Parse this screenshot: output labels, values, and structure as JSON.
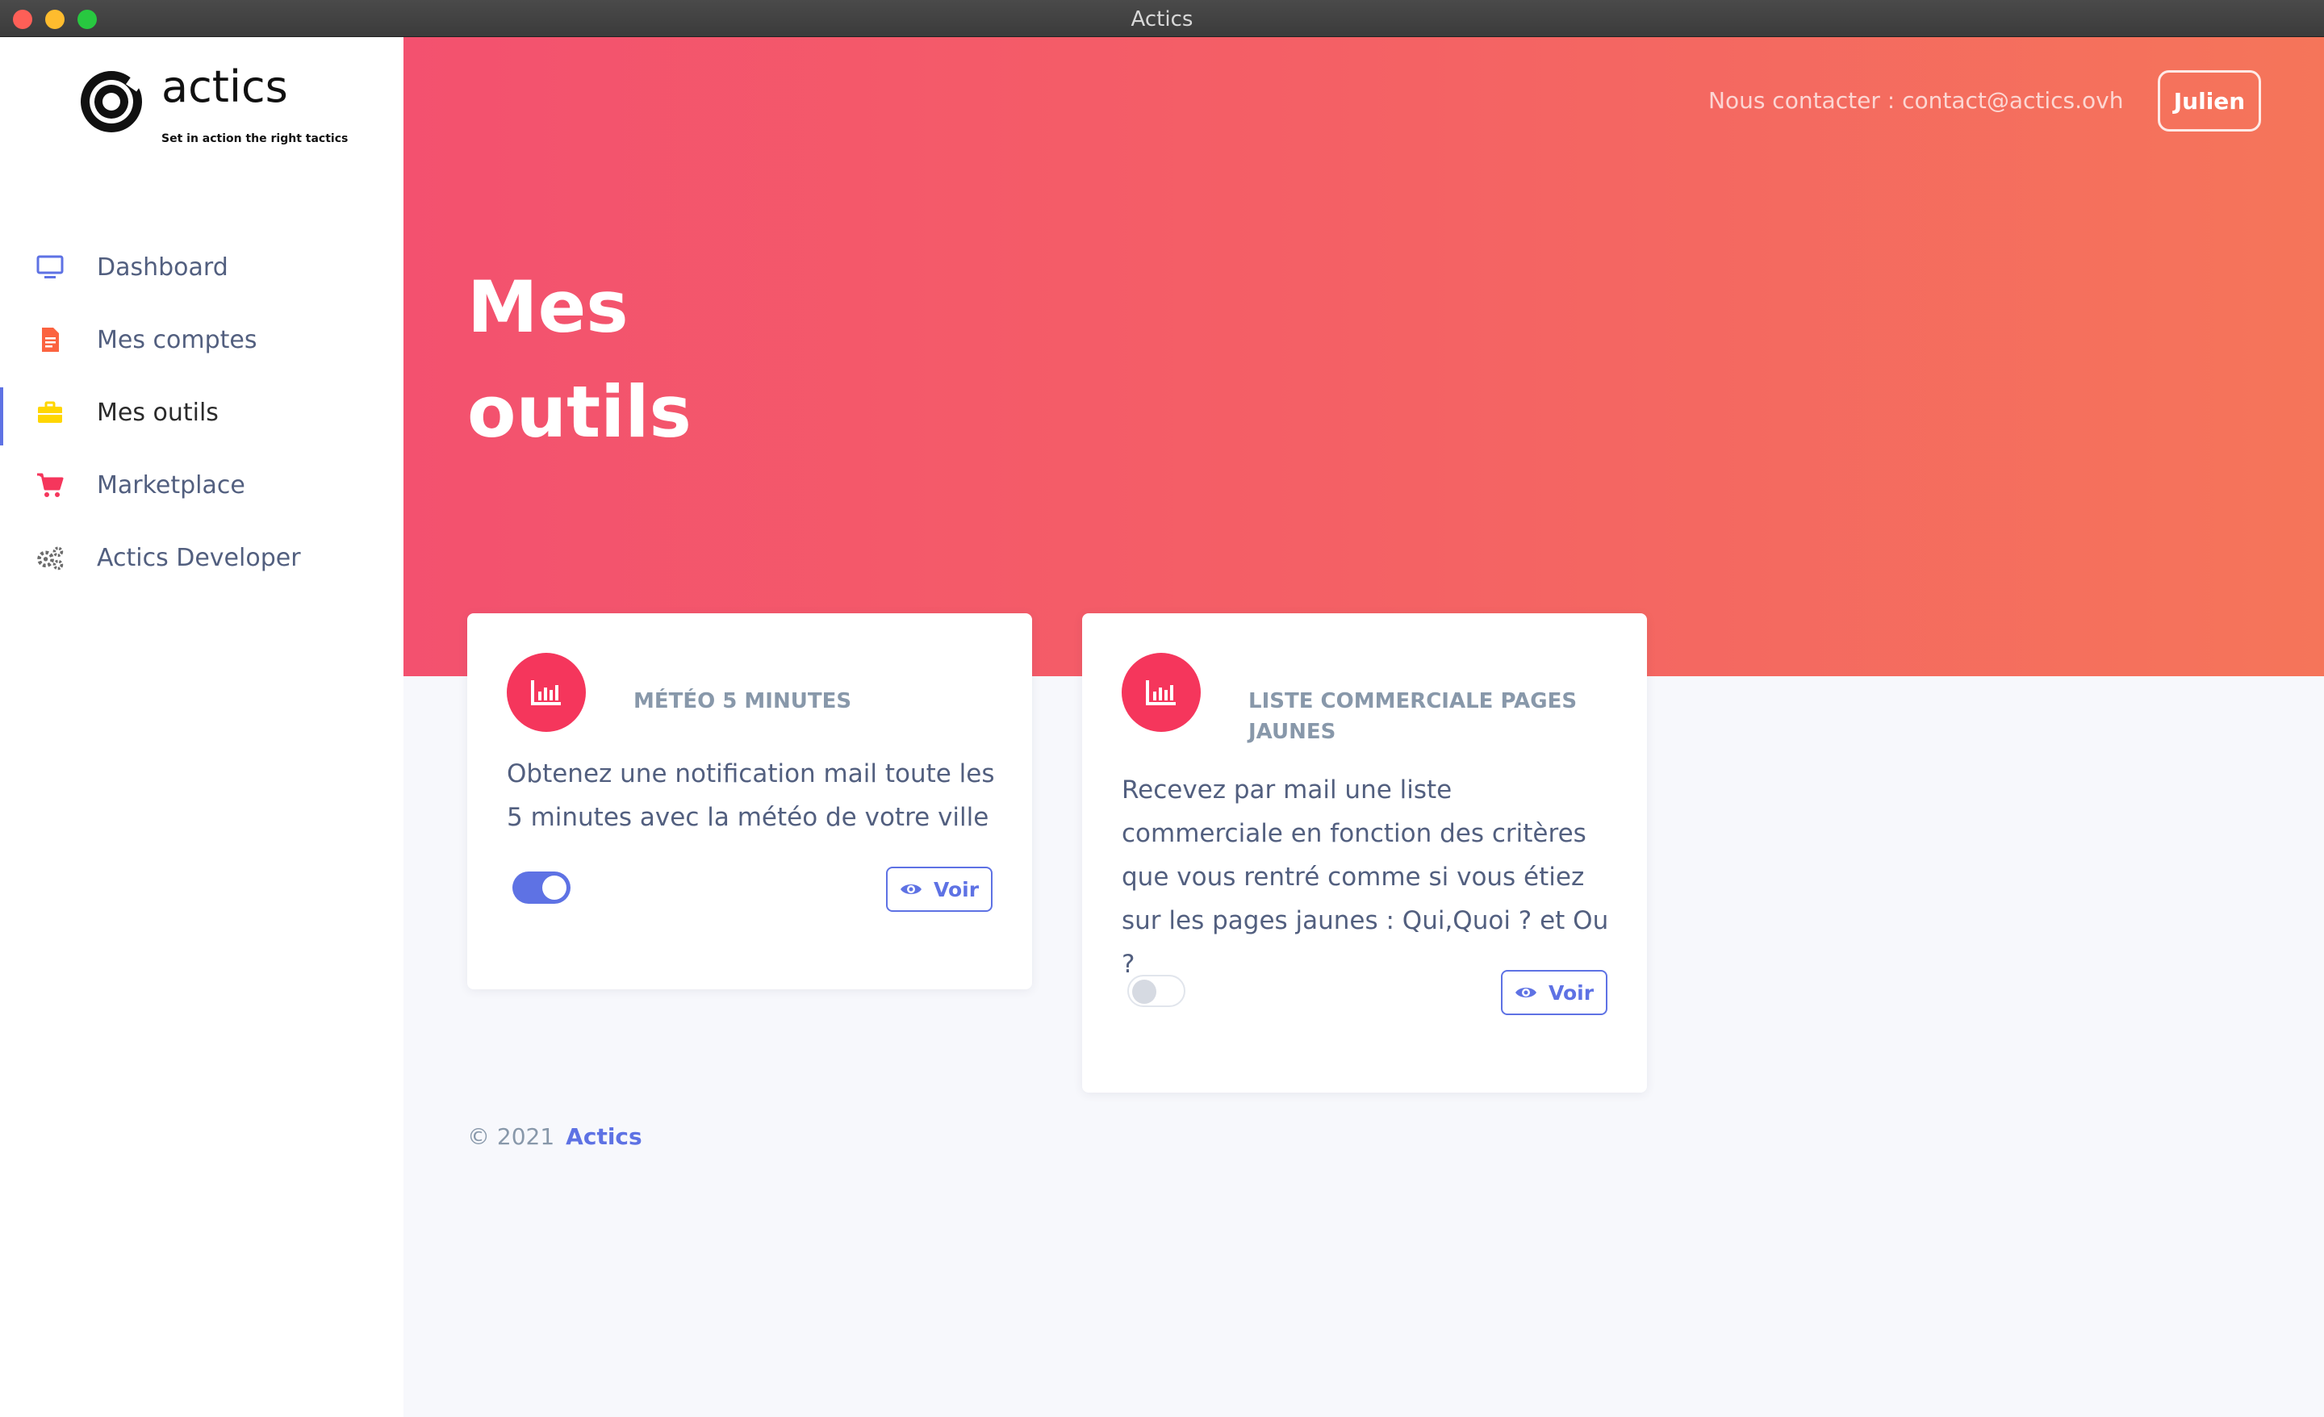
{
  "window": {
    "title": "Actics"
  },
  "logo": {
    "word": "actics",
    "tagline": "Set in action the right tactics"
  },
  "sidebar": {
    "items": [
      {
        "label": "Dashboard",
        "icon": "monitor-icon",
        "color": "#5e72e4",
        "active": false
      },
      {
        "label": "Mes comptes",
        "icon": "document-icon",
        "color": "#fb6340",
        "active": false
      },
      {
        "label": "Mes outils",
        "icon": "briefcase-icon",
        "color": "#ffd600",
        "active": true
      },
      {
        "label": "Marketplace",
        "icon": "cart-icon",
        "color": "#f5365c",
        "active": false
      },
      {
        "label": "Actics Developer",
        "icon": "gears-icon",
        "color": "#6b6b6b",
        "active": false
      }
    ]
  },
  "header": {
    "contact": "Nous contacter : contact@actics.ovh",
    "user_button": "Julien"
  },
  "page": {
    "title_line1": "Mes",
    "title_line2": "outils"
  },
  "cards": [
    {
      "icon": "bar-chart-icon",
      "title": "MÉTÉO 5 MINUTES",
      "description": "Obtenez une notification mail toute les 5 minutes avec la météo de votre ville",
      "enabled": true,
      "button": "Voir"
    },
    {
      "icon": "bar-chart-icon",
      "title": "LISTE COMMERCIALE PAGES JAUNES",
      "description": "Recevez par mail une liste commerciale en fonction des critères que vous rentré comme si vous étiez sur les pages jaunes : Qui,Quoi ? et Ou ?",
      "enabled": false,
      "button": "Voir"
    }
  ],
  "footer": {
    "copyright": "© 2021",
    "brand": "Actics"
  },
  "colors": {
    "accent": "#5e72e4",
    "hero_start": "#f3516f",
    "hero_end": "#f5755a",
    "card_icon": "#f5365c"
  }
}
